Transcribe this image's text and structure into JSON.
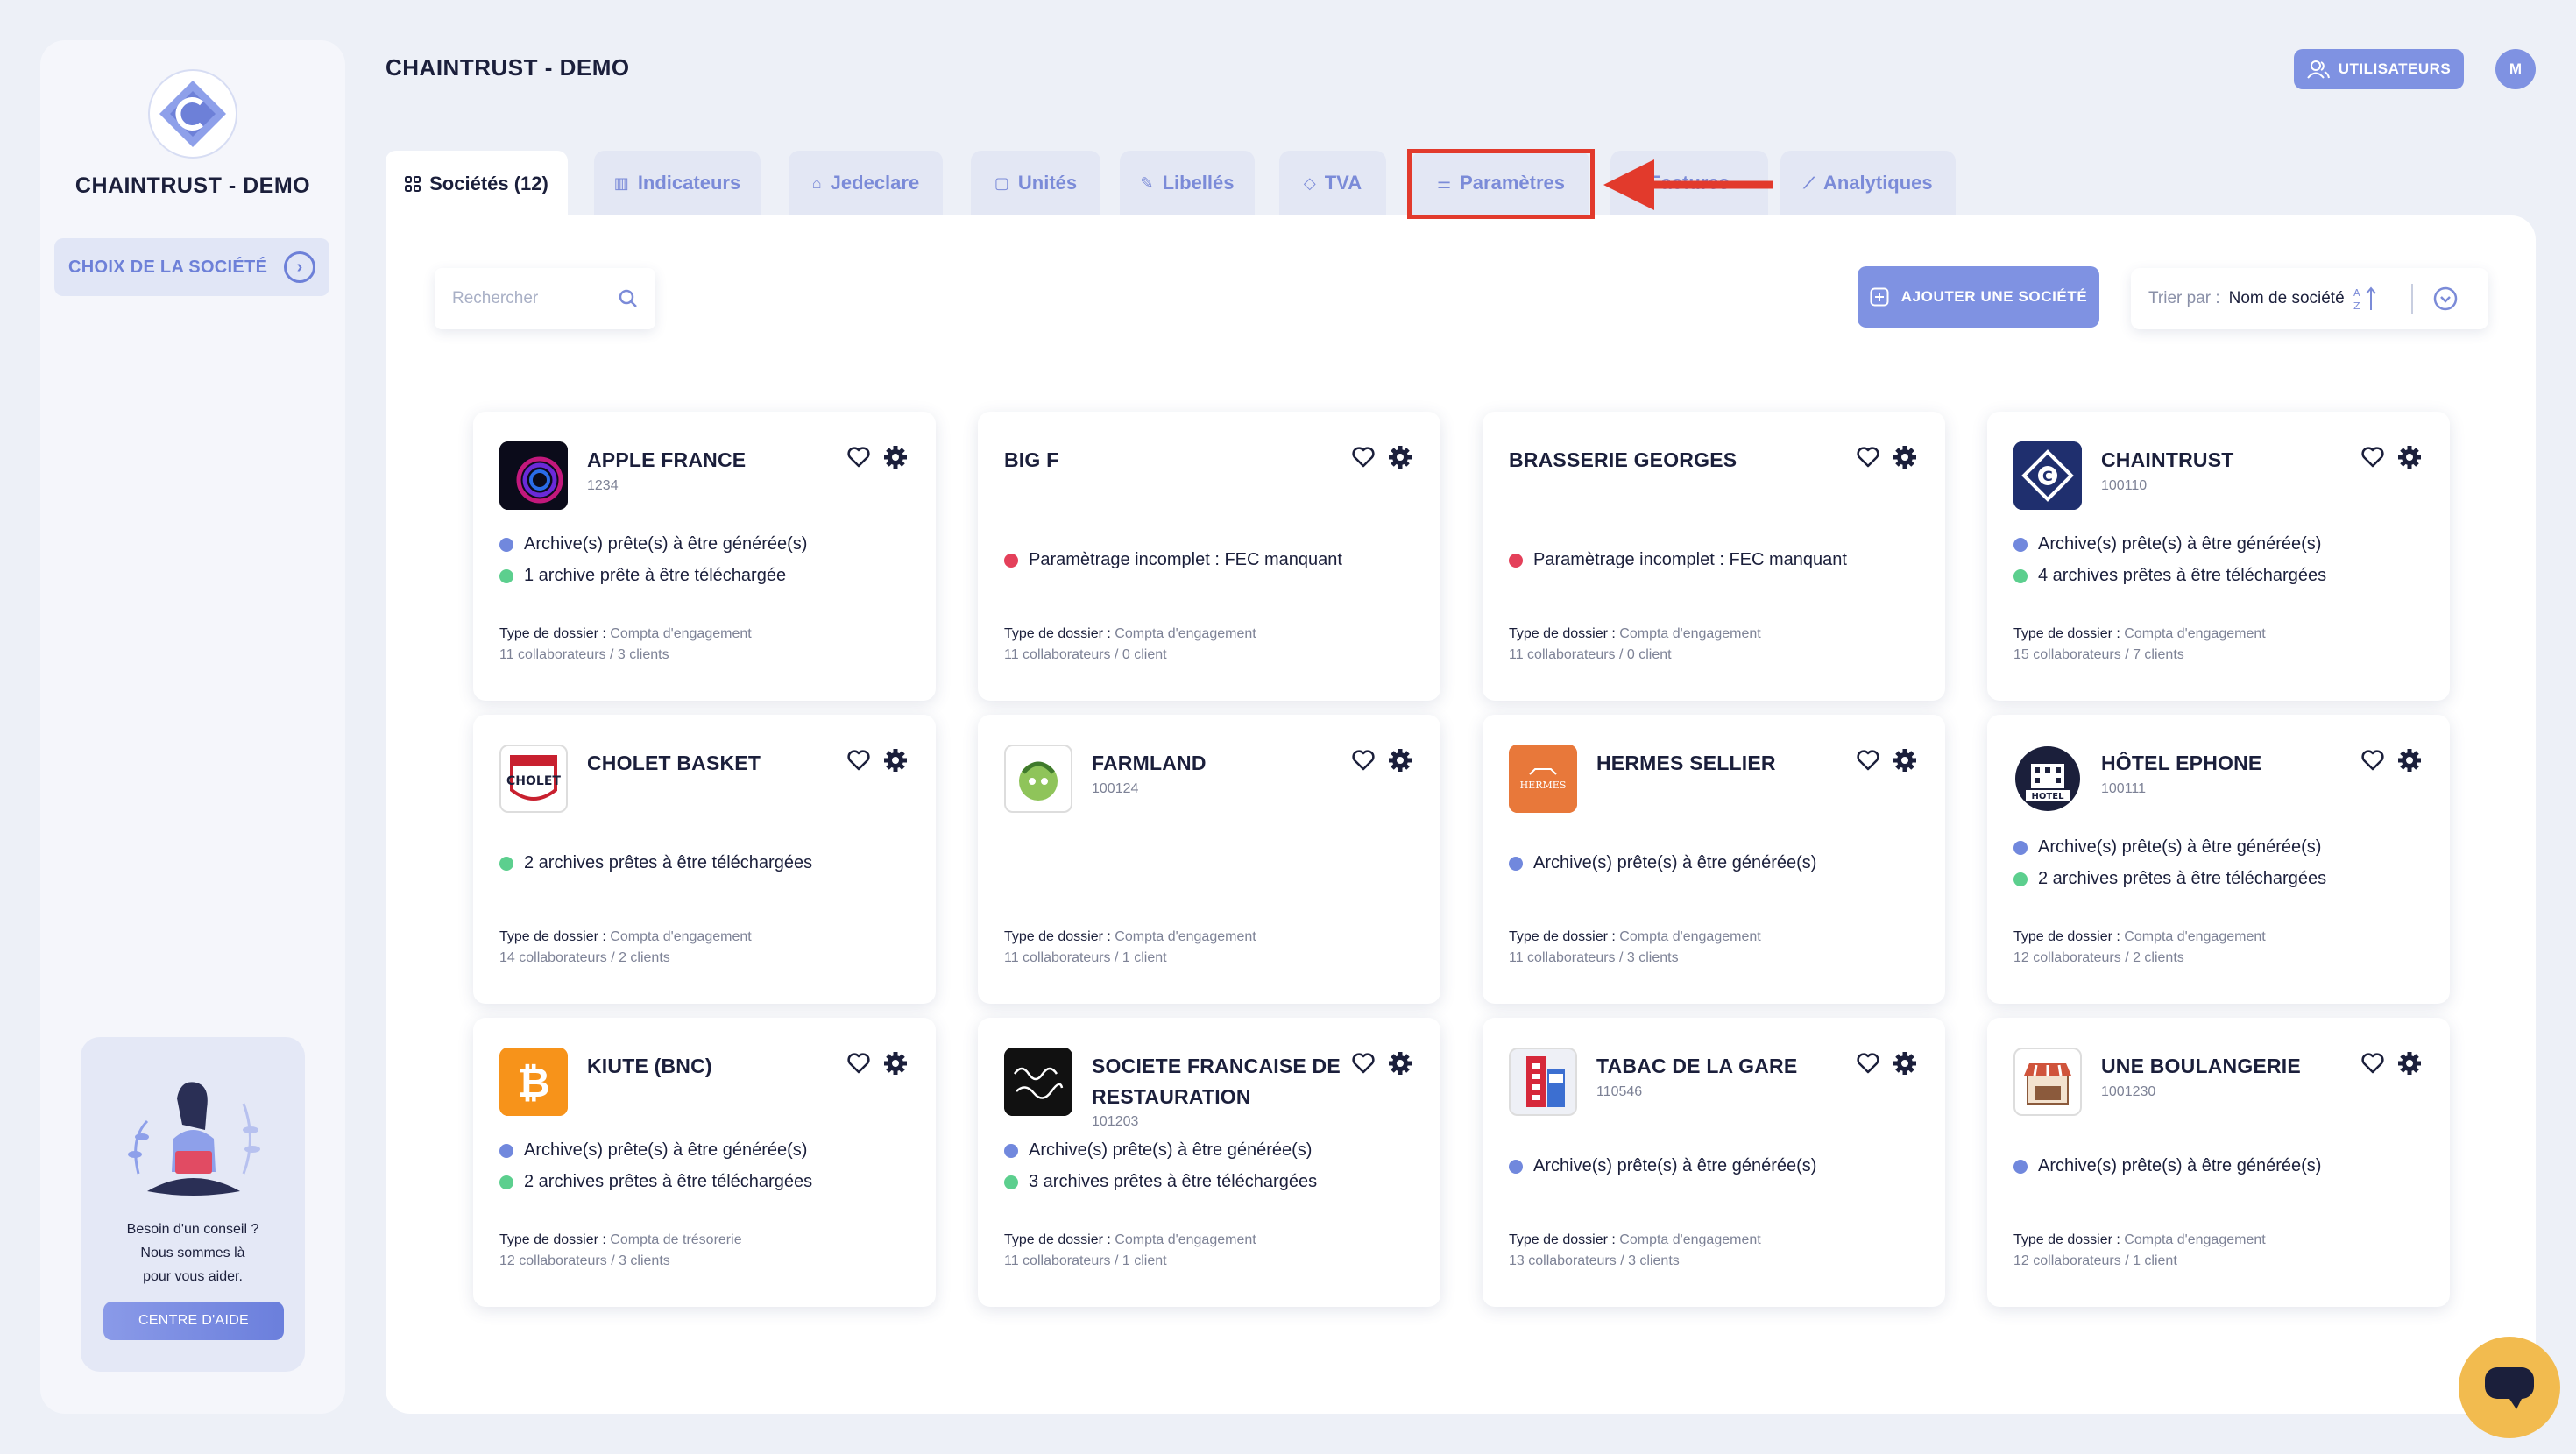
{
  "sidebar": {
    "brand": "CHAINTRUST - DEMO",
    "choose_company": "CHOIX DE LA SOCIÉTÉ",
    "help": {
      "line1": "Besoin d'un conseil ?",
      "line2": "Nous sommes là",
      "line3": "pour vous aider.",
      "button": "CENTRE D'AIDE"
    }
  },
  "header": {
    "title": "CHAINTRUST - DEMO",
    "users_button": "UTILISATEURS",
    "avatar_initial": "M"
  },
  "tabs": [
    {
      "label": "Sociétés (12)",
      "icon": "grid-icon",
      "active": true
    },
    {
      "label": "Indicateurs",
      "icon": "bar-chart-icon"
    },
    {
      "label": "Jedeclare",
      "icon": "bank-icon"
    },
    {
      "label": "Unités",
      "icon": "unit-icon"
    },
    {
      "label": "Libellés",
      "icon": "pencil-icon"
    },
    {
      "label": "TVA",
      "icon": "tag-icon"
    },
    {
      "label": "Paramètres",
      "icon": "sliders-icon"
    },
    {
      "label": "Factures",
      "icon": "invoice-icon"
    },
    {
      "label": "Analytiques",
      "icon": "line-chart-icon"
    }
  ],
  "toolbar": {
    "search_placeholder": "Rechercher",
    "add_company": "AJOUTER UNE SOCIÉTÉ",
    "sort_prefix": "Trier par :",
    "sort_value": "Nom de société"
  },
  "type_label": "Type de dossier :",
  "companies": [
    {
      "name": "APPLE FRANCE",
      "id": "1234",
      "status": [
        {
          "color": "blue",
          "text": "Archive(s) prête(s) à être générée(s)"
        },
        {
          "color": "green",
          "text": "1 archive prête à être téléchargée"
        }
      ],
      "type": "Compta d'engagement",
      "counts": "11 collaborateurs / 3 clients"
    },
    {
      "name": "BIG F",
      "id": "",
      "status": [
        {
          "color": "red",
          "text": "Paramètrage incomplet : FEC manquant"
        }
      ],
      "type": "Compta d'engagement",
      "counts": "11 collaborateurs / 0 client"
    },
    {
      "name": "BRASSERIE GEORGES",
      "id": "",
      "status": [
        {
          "color": "red",
          "text": "Paramètrage incomplet : FEC manquant"
        }
      ],
      "type": "Compta d'engagement",
      "counts": "11 collaborateurs / 0 client"
    },
    {
      "name": "CHAINTRUST",
      "id": "100110",
      "status": [
        {
          "color": "blue",
          "text": "Archive(s) prête(s) à être générée(s)"
        },
        {
          "color": "green",
          "text": "4 archives prêtes à être téléchargées"
        }
      ],
      "type": "Compta d'engagement",
      "counts": "15 collaborateurs / 7 clients"
    },
    {
      "name": "CHOLET BASKET",
      "id": "",
      "status": [
        {
          "color": "green",
          "text": "2 archives prêtes à être téléchargées"
        }
      ],
      "type": "Compta d'engagement",
      "counts": "14 collaborateurs / 2 clients"
    },
    {
      "name": "FARMLAND",
      "id": "100124",
      "status": [],
      "type": "Compta d'engagement",
      "counts": "11 collaborateurs / 1 client"
    },
    {
      "name": "HERMES SELLIER",
      "id": "",
      "status": [
        {
          "color": "blue",
          "text": "Archive(s) prête(s) à être générée(s)"
        }
      ],
      "type": "Compta d'engagement",
      "counts": "11 collaborateurs / 3 clients"
    },
    {
      "name": "HÔTEL EPHONE",
      "id": "100111",
      "status": [
        {
          "color": "blue",
          "text": "Archive(s) prête(s) à être générée(s)"
        },
        {
          "color": "green",
          "text": "2 archives prêtes à être téléchargées"
        }
      ],
      "type": "Compta d'engagement",
      "counts": "12 collaborateurs / 2 clients"
    },
    {
      "name": "KIUTE (BNC)",
      "id": "",
      "status": [
        {
          "color": "blue",
          "text": "Archive(s) prête(s) à être générée(s)"
        },
        {
          "color": "green",
          "text": "2 archives prêtes à être téléchargées"
        }
      ],
      "type": "Compta de trésorerie",
      "counts": "12 collaborateurs / 3 clients"
    },
    {
      "name": "SOCIETE FRANCAISE DE",
      "name2": "RESTAURATION",
      "id": "101203",
      "status": [
        {
          "color": "blue",
          "text": "Archive(s) prête(s) à être générée(s)"
        },
        {
          "color": "green",
          "text": "3 archives prêtes à être téléchargées"
        }
      ],
      "type": "Compta d'engagement",
      "counts": "11 collaborateurs / 1 client"
    },
    {
      "name": "TABAC DE LA GARE",
      "id": "110546",
      "status": [
        {
          "color": "blue",
          "text": "Archive(s) prête(s) à être générée(s)"
        }
      ],
      "type": "Compta d'engagement",
      "counts": "13 collaborateurs / 3 clients"
    },
    {
      "name": "UNE BOULANGERIE",
      "id": "1001230",
      "status": [
        {
          "color": "blue",
          "text": "Archive(s) prête(s) à être générée(s)"
        }
      ],
      "type": "Compta d'engagement",
      "counts": "12 collaborateurs / 1 client"
    }
  ],
  "logo_text": {
    "cholet": "CHOLET",
    "hermes": "HERMES",
    "hotel": "HOTEL"
  },
  "colors": {
    "accent": "#7f92e2",
    "highlight": "#e23a2c",
    "status_blue": "#7188dd",
    "status_green": "#5ccf8e",
    "status_red": "#e4405a",
    "chat": "#f2bb4f"
  }
}
